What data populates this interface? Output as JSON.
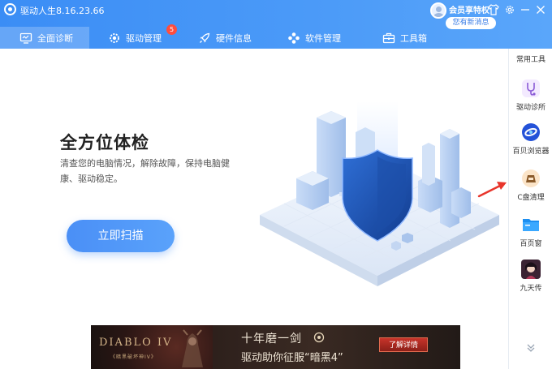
{
  "app": {
    "title": "驱动人生8.16.23.66",
    "vip_label": "会员享特权",
    "message": "您有新消息"
  },
  "nav": {
    "tabs": [
      {
        "label": "全面诊断",
        "icon": "monitor-icon",
        "active": true
      },
      {
        "label": "驱动管理",
        "icon": "gear-icon",
        "badge": "5"
      },
      {
        "label": "硬件信息",
        "icon": "rocket-icon"
      },
      {
        "label": "软件管理",
        "icon": "apps-icon"
      },
      {
        "label": "工具箱",
        "icon": "toolbox-icon"
      }
    ]
  },
  "main": {
    "title": "全方位体检",
    "description": "清查您的电脑情况，解除故障，保持电脑健康、驱动稳定。",
    "scan_button": "立即扫描"
  },
  "banner": {
    "game_logo": "DIABLO IV",
    "game_sub": "《暗黑破坏神IV》",
    "line1": "十年磨一剑",
    "line2": "驱动助你征服“暗黑4”",
    "button": "了解详情"
  },
  "sidebar": {
    "header": "常用工具",
    "items": [
      {
        "label": "驱动诊所",
        "icon": "stethoscope-icon"
      },
      {
        "label": "百贝浏览器",
        "icon": "browser-icon"
      },
      {
        "label": "C盘清理",
        "icon": "disk-clean-icon"
      },
      {
        "label": "百页窗",
        "icon": "folder-icon"
      },
      {
        "label": "九天传",
        "icon": "game-avatar-icon"
      }
    ]
  },
  "colors": {
    "primary": "#3b8df5",
    "badge": "#ff4d3d",
    "arrow": "#e8352b"
  }
}
